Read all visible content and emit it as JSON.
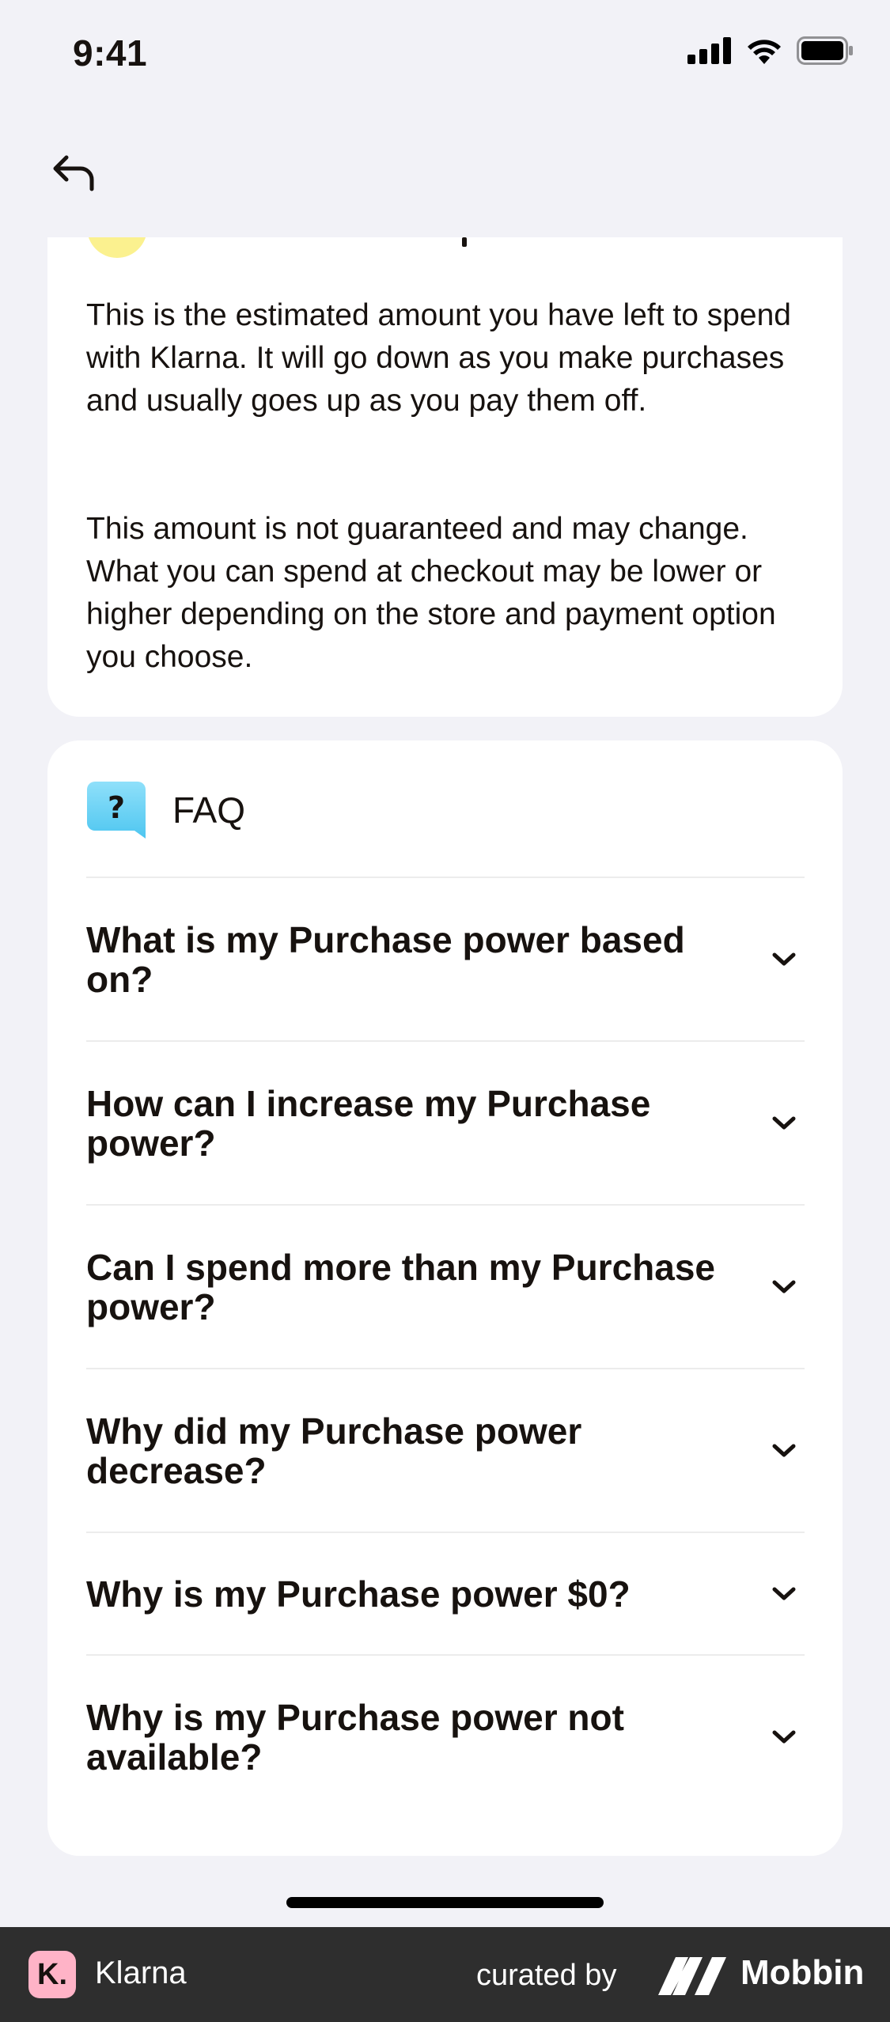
{
  "status_bar": {
    "time": "9:41"
  },
  "icons": {
    "back": "back-arrow-icon",
    "faq": "question-bubble-icon",
    "chevron": "chevron-down-icon"
  },
  "info_card": {
    "paragraph_1": "This is the estimated amount you have left to spend with Klarna. It will go down as you make purchases and usually goes up as you pay them off.",
    "paragraph_2": "This amount is not guaranteed and may change. What you can spend at checkout may be lower or higher depending on the store and payment option you choose."
  },
  "faq": {
    "title": "FAQ",
    "items": [
      {
        "question": "What is my Purchase power based on?"
      },
      {
        "question": "How can I increase my Purchase power?"
      },
      {
        "question": "Can I spend more than my Purchase power?"
      },
      {
        "question": "Why did my Purchase power decrease?"
      },
      {
        "question": "Why is my Purchase power $0?"
      },
      {
        "question": "Why is my Purchase power not available?"
      }
    ]
  },
  "footer": {
    "app_logo_letter": "K.",
    "app_name": "Klarna",
    "curated_by": "curated by",
    "brand_name": "Mobbin"
  },
  "colors": {
    "background": "#f2f2f7",
    "card": "#ffffff",
    "text": "#17120f",
    "accent_yellow": "#fbf18f",
    "faq_icon_blue": "#6ad3f5",
    "klarna_pink": "#ffb3c7",
    "footer_bg": "#2e2e2e"
  }
}
